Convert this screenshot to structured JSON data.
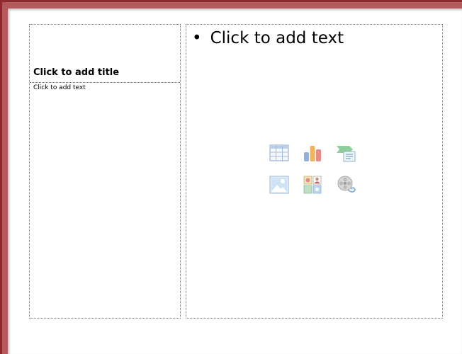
{
  "slide": {
    "title_placeholder": "Click to add title",
    "left_text_placeholder": "Click to add text",
    "right_text_placeholder": "Click to add text",
    "bullet": "•"
  },
  "insert_icons": [
    {
      "name": "insert-table-icon"
    },
    {
      "name": "insert-chart-icon"
    },
    {
      "name": "insert-smartart-icon"
    },
    {
      "name": "insert-picture-icon"
    },
    {
      "name": "insert-clip-art-icon"
    },
    {
      "name": "insert-media-clip-icon"
    }
  ],
  "colors": {
    "frame": "#8e2a2e",
    "frame_highlight": "#b25a5c",
    "placeholder_border": "#7a7a7a"
  }
}
